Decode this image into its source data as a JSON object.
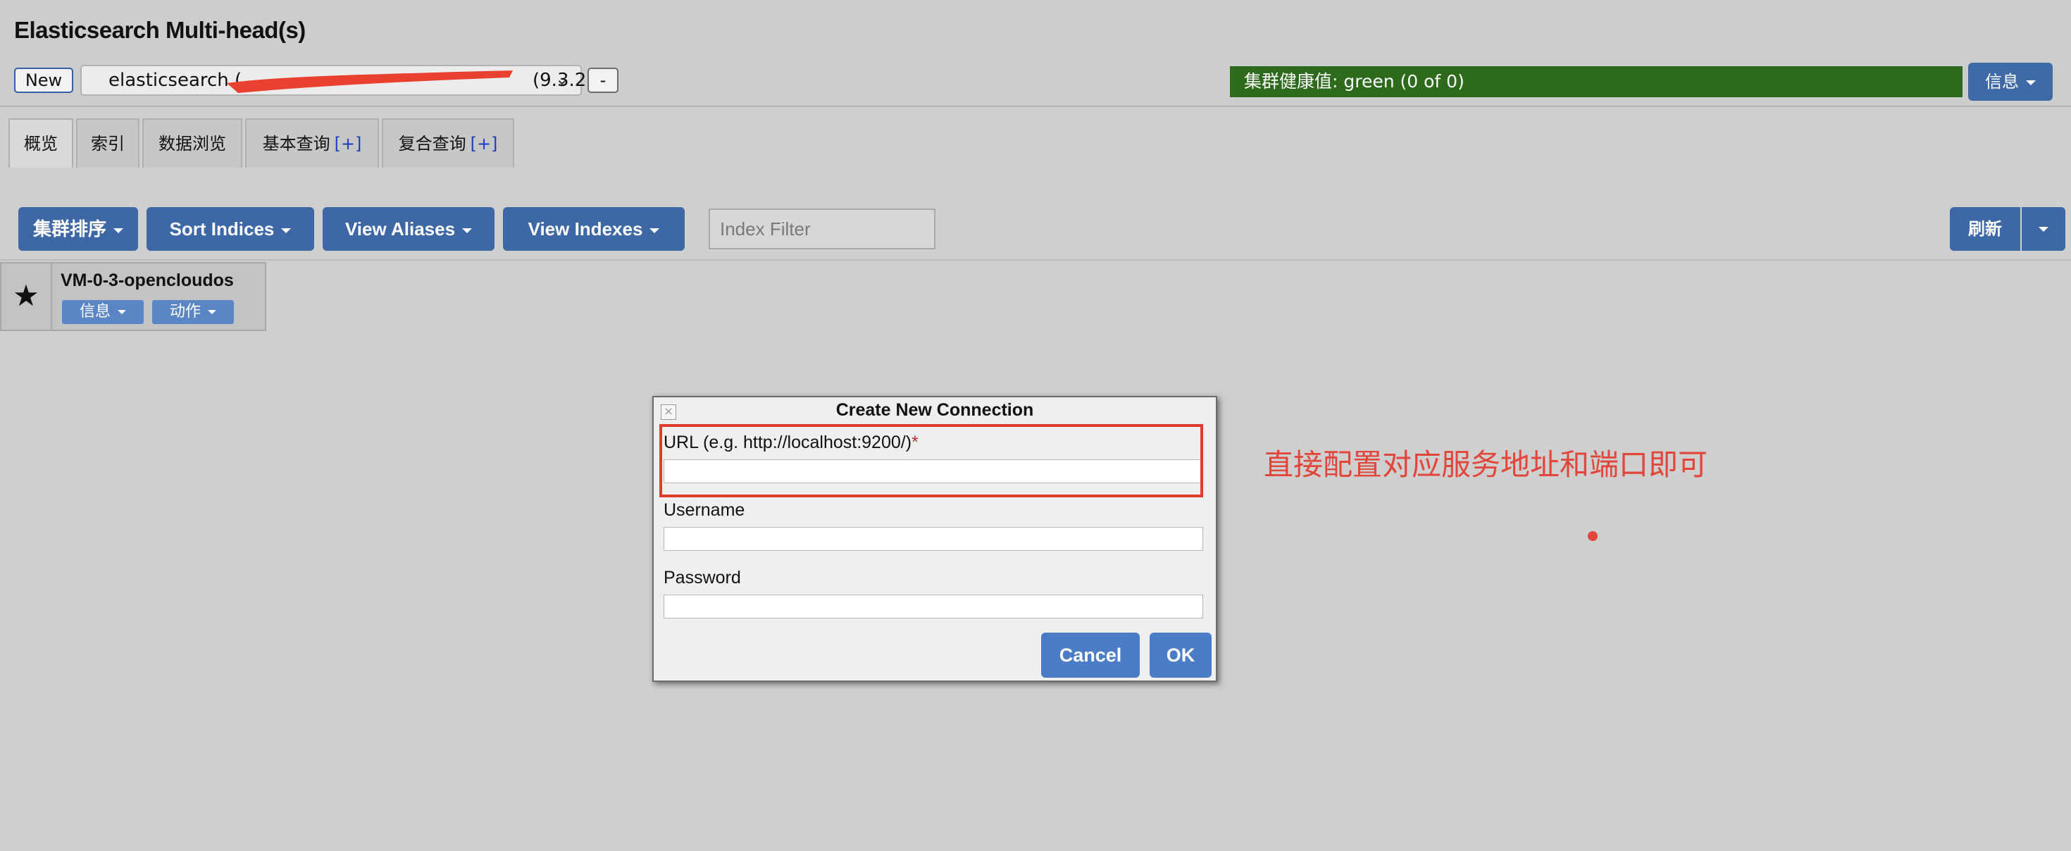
{
  "header": {
    "title": "Elasticsearch Multi-head(s)",
    "new_label": "New",
    "connection_name": "elasticsearch (",
    "connection_version": "(9.3.2)",
    "remove_label": "-",
    "health": "集群健康值: green (0 of 0)",
    "info_label": "信息"
  },
  "tabs": [
    {
      "label": "概览",
      "plus": ""
    },
    {
      "label": "索引",
      "plus": ""
    },
    {
      "label": "数据浏览",
      "plus": ""
    },
    {
      "label": "基本查询",
      "plus": "[+]"
    },
    {
      "label": "复合查询",
      "plus": "[+]"
    }
  ],
  "toolbar": {
    "cluster_sort": "集群排序",
    "sort_indices": "Sort Indices",
    "view_aliases": "View Aliases",
    "view_indexes": "View Indexes",
    "index_filter_placeholder": "Index Filter",
    "refresh": "刷新"
  },
  "node": {
    "name": "VM-0-3-opencloudos",
    "info_label": "信息",
    "action_label": "动作"
  },
  "dialog": {
    "title": "Create New Connection",
    "url_label": "URL (e.g. http://localhost:9200/)",
    "required_mark": "*",
    "username_label": "Username",
    "password_label": "Password",
    "cancel_label": "Cancel",
    "ok_label": "OK"
  },
  "annotation": {
    "text": "直接配置对应服务地址和端口即可",
    "color": "#e2463a"
  },
  "colors": {
    "health_green": "#2d6a1b",
    "button_blue": "#3e67a6",
    "highlight_red": "#e03c2d"
  }
}
